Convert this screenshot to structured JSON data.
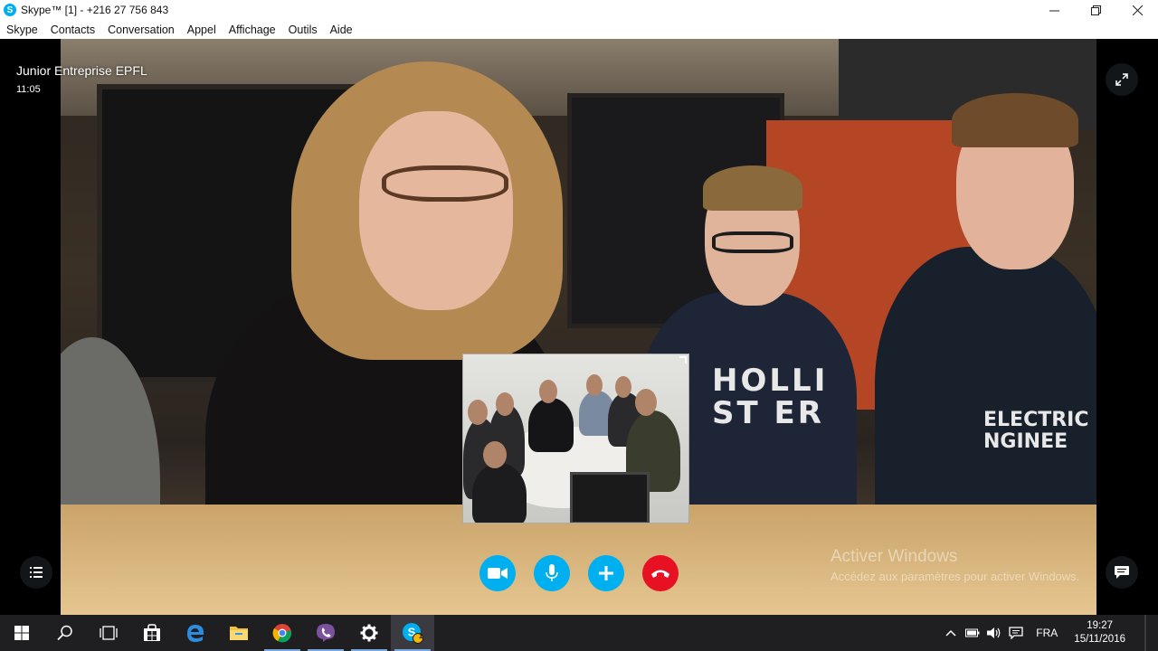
{
  "window": {
    "title": "Skype™ [1] - +216 27 756 843",
    "controls": {
      "minimize": "—",
      "maximize": "❐",
      "close": "✕"
    }
  },
  "menu": {
    "items": [
      "Skype",
      "Contacts",
      "Conversation",
      "Appel",
      "Affichage",
      "Outils",
      "Aide"
    ]
  },
  "call": {
    "contact_name": "Junior Entreprise EPFL",
    "duration": "11:05",
    "buttons": {
      "video": "video-camera-icon",
      "mic": "microphone-icon",
      "add": "plus-icon",
      "hangup": "hang-up-icon"
    },
    "colors": {
      "primary": "#00aff0",
      "hangup": "#e81123"
    }
  },
  "video_content": {
    "hoodie_lines": [
      "HOLLI",
      "ST ER"
    ],
    "hoodie2_lines": [
      "ELECTRIC",
      "NGINEE"
    ]
  },
  "watermark": {
    "title": "Activer Windows",
    "subtitle": "Accédez aux paramètres pour activer Windows."
  },
  "taskbar": {
    "apps": [
      "start",
      "search",
      "task-view",
      "store",
      "edge",
      "file-explorer",
      "chrome",
      "viber",
      "settings",
      "skype"
    ],
    "skype_badge": "1",
    "language": "FRA",
    "time": "19:27",
    "date": "15/11/2016"
  }
}
